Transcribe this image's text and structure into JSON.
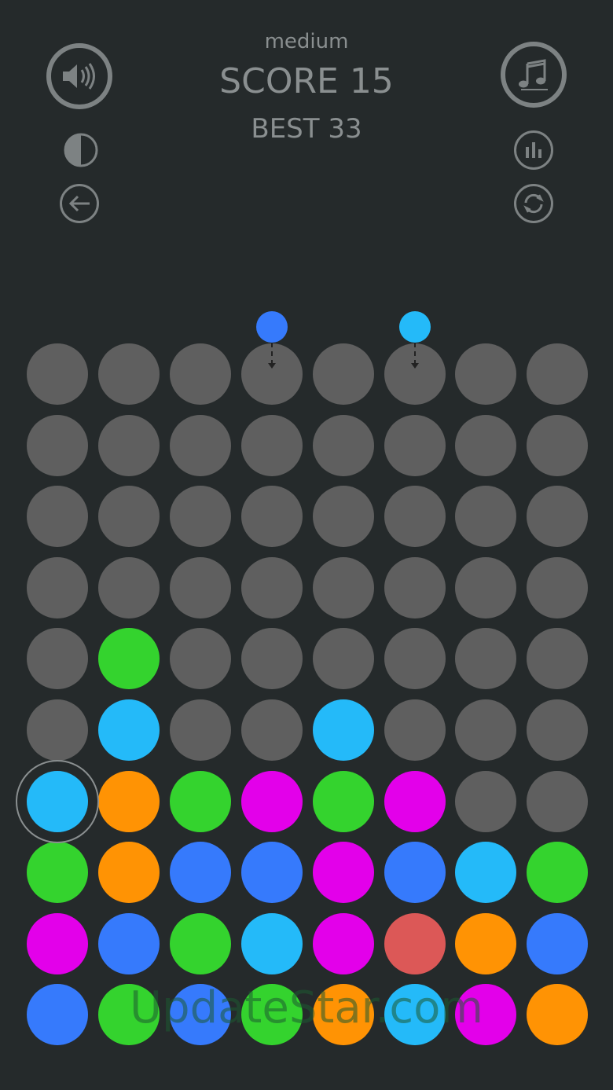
{
  "hud": {
    "difficulty": "medium",
    "score_label": "SCORE 15",
    "best_label": "BEST 33"
  },
  "buttons": {
    "sound": "speaker-icon",
    "music": "music-note-icon",
    "theme": "contrast-icon",
    "back": "arrow-left-icon",
    "stats": "bar-chart-icon",
    "restart": "refresh-icon"
  },
  "colors": {
    "empty": "#5f5f5f",
    "green": "#34d32e",
    "cyan": "#24baf9",
    "orange": "#ff9304",
    "magenta": "#e300ea",
    "blue": "#367afc",
    "red": "#dc5857"
  },
  "board": {
    "columns": 8,
    "rows": 10,
    "grid": [
      [
        "empty",
        "empty",
        "empty",
        "empty",
        "empty",
        "empty",
        "empty",
        "empty"
      ],
      [
        "empty",
        "empty",
        "empty",
        "empty",
        "empty",
        "empty",
        "empty",
        "empty"
      ],
      [
        "empty",
        "empty",
        "empty",
        "empty",
        "empty",
        "empty",
        "empty",
        "empty"
      ],
      [
        "empty",
        "empty",
        "empty",
        "empty",
        "empty",
        "empty",
        "empty",
        "empty"
      ],
      [
        "empty",
        "green",
        "empty",
        "empty",
        "empty",
        "empty",
        "empty",
        "empty"
      ],
      [
        "empty",
        "cyan",
        "empty",
        "empty",
        "cyan",
        "empty",
        "empty",
        "empty"
      ],
      [
        "cyan",
        "orange",
        "green",
        "magenta",
        "green",
        "magenta",
        "empty",
        "empty"
      ],
      [
        "green",
        "orange",
        "blue",
        "blue",
        "magenta",
        "blue",
        "cyan",
        "green"
      ],
      [
        "magenta",
        "blue",
        "green",
        "cyan",
        "magenta",
        "red",
        "orange",
        "blue"
      ],
      [
        "blue",
        "green",
        "blue",
        "green",
        "orange",
        "cyan",
        "magenta",
        "orange"
      ]
    ],
    "incoming": [
      {
        "column": 3,
        "color": "blue"
      },
      {
        "column": 5,
        "color": "cyan"
      }
    ],
    "selected": {
      "row": 6,
      "column": 0
    }
  },
  "watermark": "UpdateStar.com"
}
